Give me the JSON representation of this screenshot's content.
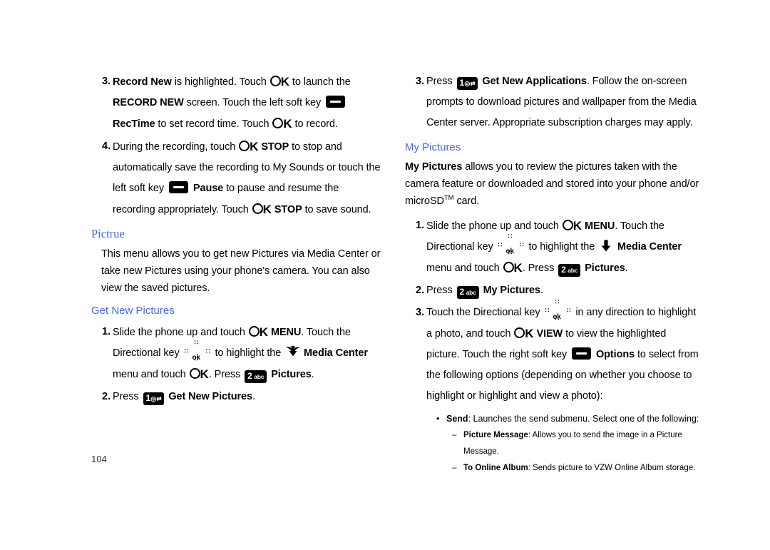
{
  "page": {
    "number": "104",
    "heading_color": "#4169e8"
  },
  "left_column": {
    "steps": [
      {
        "num": "3.",
        "segments": [
          {
            "t": "text",
            "bold": true,
            "v": "Record New"
          },
          {
            "t": "text",
            "bold": false,
            "v": " is highlighted. Touch "
          },
          {
            "t": "icon",
            "v": "ok-key"
          },
          {
            "t": "text",
            "bold": false,
            "v": " to launch the "
          },
          {
            "t": "text",
            "bold": true,
            "v": "RECORD NEW"
          },
          {
            "t": "text",
            "bold": false,
            "v": " screen. Touch the left soft key "
          },
          {
            "t": "icon",
            "v": "soft-key"
          },
          {
            "t": "text",
            "bold": false,
            "v": " "
          },
          {
            "t": "text",
            "bold": true,
            "v": "RecTime"
          },
          {
            "t": "text",
            "bold": false,
            "v": " to set record time. Touch "
          },
          {
            "t": "icon",
            "v": "ok-key"
          },
          {
            "t": "text",
            "bold": false,
            "v": " to record."
          }
        ]
      },
      {
        "num": "4.",
        "segments": [
          {
            "t": "text",
            "bold": false,
            "v": "During the recording, touch "
          },
          {
            "t": "icon",
            "v": "ok-key"
          },
          {
            "t": "text",
            "bold": true,
            "v": " STOP"
          },
          {
            "t": "text",
            "bold": false,
            "v": " to stop and automatically save the recording to My Sounds or touch the left soft key "
          },
          {
            "t": "icon",
            "v": "soft-key"
          },
          {
            "t": "text",
            "bold": false,
            "v": " "
          },
          {
            "t": "text",
            "bold": true,
            "v": "Pause"
          },
          {
            "t": "text",
            "bold": false,
            "v": " to pause and resume the recording appropriately. Touch "
          },
          {
            "t": "icon",
            "v": "ok-key"
          },
          {
            "t": "text",
            "bold": true,
            "v": " STOP"
          },
          {
            "t": "text",
            "bold": false,
            "v": " to save sound."
          }
        ]
      }
    ],
    "heading_picture": "Pictrue",
    "intro_paragraph": "This menu allows you to get new Pictures via Media Center or take new Pictures using your phone's camera. You can also view the saved pictures.",
    "heading_get_new_pictures": "Get New Pictures",
    "steps2": [
      {
        "num": "1.",
        "segments": [
          {
            "t": "text",
            "bold": false,
            "v": "Slide the phone up and touch "
          },
          {
            "t": "icon",
            "v": "ok-key"
          },
          {
            "t": "text",
            "bold": true,
            "v": " MENU"
          },
          {
            "t": "text",
            "bold": false,
            "v": ". Touch the Directional key "
          },
          {
            "t": "icon",
            "v": "dir-key"
          },
          {
            "t": "text",
            "bold": false,
            "v": " to highlight the "
          },
          {
            "t": "icon",
            "v": "arrow-down-curved"
          },
          {
            "t": "text",
            "bold": false,
            "v": " "
          },
          {
            "t": "text",
            "bold": true,
            "v": "Media Center"
          },
          {
            "t": "text",
            "bold": false,
            "v": " menu and touch "
          },
          {
            "t": "icon",
            "v": "ok-key"
          },
          {
            "t": "text",
            "bold": false,
            "v": ". Press "
          },
          {
            "t": "icon",
            "v": "key-2abc"
          },
          {
            "t": "text",
            "bold": false,
            "v": " "
          },
          {
            "t": "text",
            "bold": true,
            "v": "Pictures"
          },
          {
            "t": "text",
            "bold": false,
            "v": "."
          }
        ]
      },
      {
        "num": "2.",
        "segments": [
          {
            "t": "text",
            "bold": false,
            "v": "Press "
          },
          {
            "t": "icon",
            "v": "key-1at"
          },
          {
            "t": "text",
            "bold": false,
            "v": " "
          },
          {
            "t": "text",
            "bold": true,
            "v": "Get New Pictures"
          },
          {
            "t": "text",
            "bold": false,
            "v": "."
          }
        ]
      }
    ]
  },
  "right_column": {
    "steps": [
      {
        "num": "3.",
        "segments": [
          {
            "t": "text",
            "bold": false,
            "v": "Press "
          },
          {
            "t": "icon",
            "v": "key-1at"
          },
          {
            "t": "text",
            "bold": false,
            "v": " "
          },
          {
            "t": "text",
            "bold": true,
            "v": "Get New Applications"
          },
          {
            "t": "text",
            "bold": false,
            "v": ". Follow the on-screen prompts to download pictures and wallpaper from the Media Center server. Appropriate subscription charges may apply."
          }
        ]
      }
    ],
    "heading_my_pictures": "My Pictures",
    "intro_segments": [
      {
        "t": "text",
        "bold": true,
        "v": "My Pictures"
      },
      {
        "t": "text",
        "bold": false,
        "v": " allows you to review the pictures taken with the camera feature or downloaded and stored into your phone and/or microSD"
      },
      {
        "t": "sup",
        "bold": false,
        "v": "TM"
      },
      {
        "t": "text",
        "bold": false,
        "v": " card."
      }
    ],
    "steps2": [
      {
        "num": "1.",
        "segments": [
          {
            "t": "text",
            "bold": false,
            "v": "Slide the phone up and touch "
          },
          {
            "t": "icon",
            "v": "ok-key"
          },
          {
            "t": "text",
            "bold": true,
            "v": " MENU"
          },
          {
            "t": "text",
            "bold": false,
            "v": ". Touch the Directional key "
          },
          {
            "t": "icon",
            "v": "dir-key"
          },
          {
            "t": "text",
            "bold": false,
            "v": " to highlight the "
          },
          {
            "t": "icon",
            "v": "arrow-down-plain"
          },
          {
            "t": "text",
            "bold": false,
            "v": " "
          },
          {
            "t": "text",
            "bold": true,
            "v": "Media Center"
          },
          {
            "t": "text",
            "bold": false,
            "v": " menu and touch "
          },
          {
            "t": "icon",
            "v": "ok-key"
          },
          {
            "t": "text",
            "bold": false,
            "v": ". Press "
          },
          {
            "t": "icon",
            "v": "key-2abc"
          },
          {
            "t": "text",
            "bold": false,
            "v": " "
          },
          {
            "t": "text",
            "bold": true,
            "v": "Pictures"
          },
          {
            "t": "text",
            "bold": false,
            "v": "."
          }
        ]
      },
      {
        "num": "2.",
        "segments": [
          {
            "t": "text",
            "bold": false,
            "v": "Press "
          },
          {
            "t": "icon",
            "v": "key-2abc"
          },
          {
            "t": "text",
            "bold": false,
            "v": " "
          },
          {
            "t": "text",
            "bold": true,
            "v": "My Pictures"
          },
          {
            "t": "text",
            "bold": false,
            "v": "."
          }
        ]
      },
      {
        "num": "3.",
        "segments": [
          {
            "t": "text",
            "bold": false,
            "v": "Touch the Directional key "
          },
          {
            "t": "icon",
            "v": "dir-key"
          },
          {
            "t": "text",
            "bold": false,
            "v": " in any direction to highlight a photo, and touch "
          },
          {
            "t": "icon",
            "v": "ok-key"
          },
          {
            "t": "text",
            "bold": true,
            "v": " VIEW"
          },
          {
            "t": "text",
            "bold": false,
            "v": " to view the highlighted picture. Touch the right soft key "
          },
          {
            "t": "icon",
            "v": "soft-key"
          },
          {
            "t": "text",
            "bold": false,
            "v": " "
          },
          {
            "t": "text",
            "bold": true,
            "v": "Options"
          },
          {
            "t": "text",
            "bold": false,
            "v": " to select from the following options (depending on whether you choose to highlight or highlight and view a photo):"
          }
        ]
      }
    ],
    "bullets": [
      {
        "level": 1,
        "mark": "•",
        "label": "Send",
        "text": ": Launches the send submenu. Select one of the following:"
      },
      {
        "level": 2,
        "mark": "–",
        "label": "Picture Message",
        "text": ": Allows you to send the image in a Picture Message."
      },
      {
        "level": 2,
        "mark": "–",
        "label": "To Online Album",
        "text": ": Sends picture to VZW Online Album storage."
      }
    ]
  },
  "icons": {
    "ok_key": "ok-key",
    "soft_key": "soft-key",
    "key_1at": "1@",
    "key_1at_small": "↵",
    "key_2abc_big": "2",
    "key_2abc_small": "abc",
    "dir_key_center": "ok",
    "dir_key_hash": "••",
    "arrow_down": "arrow-down-icon"
  }
}
